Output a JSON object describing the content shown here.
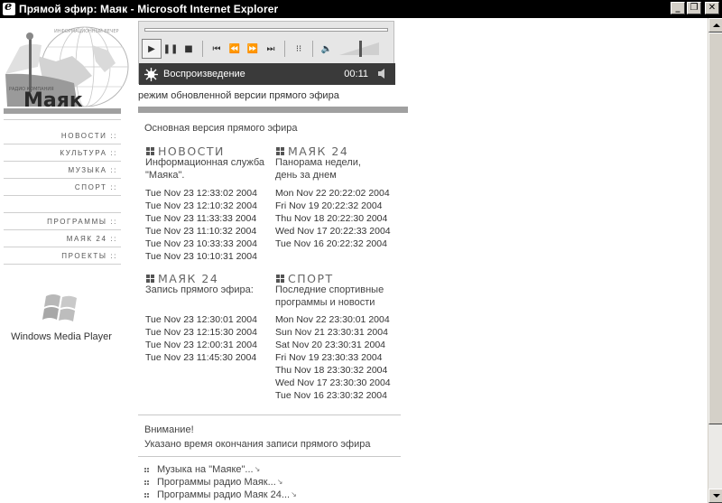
{
  "window": {
    "title": "Прямой эфир: Маяк - Microsoft Internet Explorer",
    "minimize": "_",
    "restore": "❐",
    "close": "✕"
  },
  "nav": {
    "items": [
      "НОВОСТИ ::",
      "КУЛЬТУРА ::",
      "МУЗЫКА ::",
      "СПОРТ ::",
      "ПРОГРАММЫ ::",
      "МАЯК 24 ::",
      "ПРОЕКТЫ ::"
    ],
    "wmp_label": "Windows Media Player"
  },
  "player": {
    "status": "Воспроизведение",
    "time": "00:11",
    "buttons": {
      "play": "▶",
      "pause": "❚❚",
      "stop": "■",
      "prev": "⏮",
      "rewind": "⏪",
      "forward": "⏩",
      "next": "⏭",
      "eq": "⁝⁝",
      "volume": "🔈"
    }
  },
  "caption": "режим обновленной версии прямого эфира",
  "main_title": "Основная версия прямого эфира",
  "sections": {
    "news": {
      "heading": "НОВОСТИ",
      "sub": [
        "Информационная служба",
        "\"Маяка\"."
      ],
      "dates": [
        "Tue Nov 23 12:33:02 2004",
        "Tue Nov 23 12:10:32 2004",
        "Tue Nov 23 11:33:33 2004",
        "Tue Nov 23 11:10:32 2004",
        "Tue Nov 23 10:33:33 2004",
        "Tue Nov 23 10:10:31 2004"
      ]
    },
    "mayak24_panorama": {
      "heading": "МАЯК 24",
      "sub": [
        "Панорама недели,",
        "день за днем"
      ],
      "dates": [
        "Mon Nov 22 20:22:02 2004",
        "Fri Nov 19 20:22:32 2004",
        "Thu Nov 18 20:22:30 2004",
        "Wed Nov 17 20:22:33 2004",
        "Tue Nov 16 20:22:32 2004"
      ]
    },
    "mayak24_record": {
      "heading": "МАЯК 24",
      "sub": [
        "Запись прямого эфира:"
      ],
      "dates": [
        "Tue Nov 23 12:30:01 2004",
        "Tue Nov 23 12:15:30 2004",
        "Tue Nov 23 12:00:31 2004",
        "Tue Nov 23 11:45:30 2004"
      ]
    },
    "sport": {
      "heading": "СПОРТ",
      "sub": [
        "Последние спортивные",
        "программы и новости"
      ],
      "dates": [
        "Mon Nov 22 23:30:01 2004",
        "Sun Nov 21 23:30:31 2004",
        "Sat Nov 20 23:30:31 2004",
        "Fri Nov 19 23:30:33 2004",
        "Thu Nov 18 23:30:32 2004",
        "Wed Nov 17 23:30:30 2004",
        "Tue Nov 16 23:30:32 2004"
      ]
    }
  },
  "notice": {
    "title": "Внимание!",
    "text": "Указано время окончания записи прямого эфира"
  },
  "links": [
    "Музыка на \"Маяке\"...",
    "Программы радио Маяк...",
    "Программы радио Маяк 24..."
  ],
  "logo": {
    "brand": "Маяк",
    "arc_text": "ИНФОРМАЦИОННЫЙ ВЕЧЕР",
    "side_text": "РАДИО КОМПАНИЯ"
  }
}
